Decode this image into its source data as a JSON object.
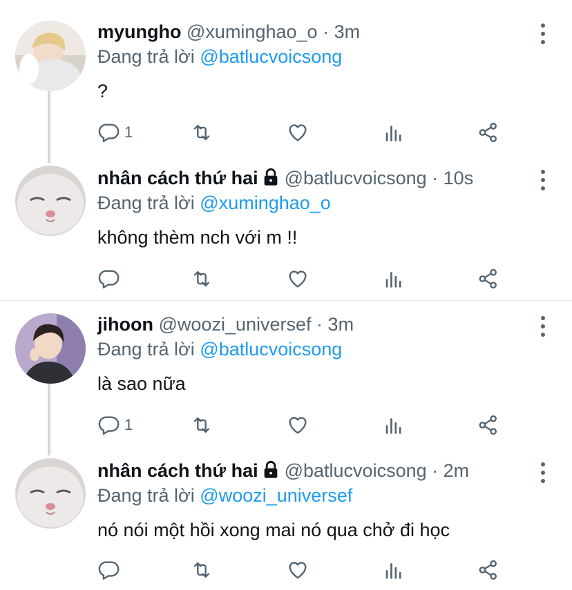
{
  "replying_prefix": "Đang trả lời",
  "tweets": [
    {
      "name": "myungho",
      "handle": "@xuminghao_o",
      "sep": "·",
      "time": "3m",
      "reply_to": "@batlucvoicsong",
      "text": "?",
      "reply_count": "1",
      "avatar": "person"
    },
    {
      "name": "nhân cách thứ hai",
      "handle": "@batlucvoicsong",
      "sep": "·",
      "time": "10s",
      "reply_to": "@xuminghao_o",
      "text": "không thèm nch với m !!",
      "reply_count": "",
      "avatar": "cat"
    },
    {
      "name": "jihoon",
      "handle": "@woozi_universef",
      "sep": "·",
      "time": "3m",
      "reply_to": "@batlucvoicsong",
      "text": "là sao nữa",
      "reply_count": "1",
      "avatar": "person"
    },
    {
      "name": "nhân cách thứ hai",
      "handle": "@batlucvoicsong",
      "sep": "·",
      "time": "2m",
      "reply_to": "@woozi_universef",
      "text": "nó nói một hồi xong mai nó qua chở đi học",
      "reply_count": "",
      "avatar": "cat"
    }
  ],
  "icons": {
    "reply": "reply-icon",
    "retweet": "retweet-icon",
    "like": "heart-icon",
    "views": "analytics-icon",
    "share": "share-icon",
    "more": "more-icon",
    "lock": "lock-icon"
  },
  "colors": {
    "mention": "#1d9bf0",
    "secondary": "#536471",
    "thread_line": "#cfd9de"
  }
}
